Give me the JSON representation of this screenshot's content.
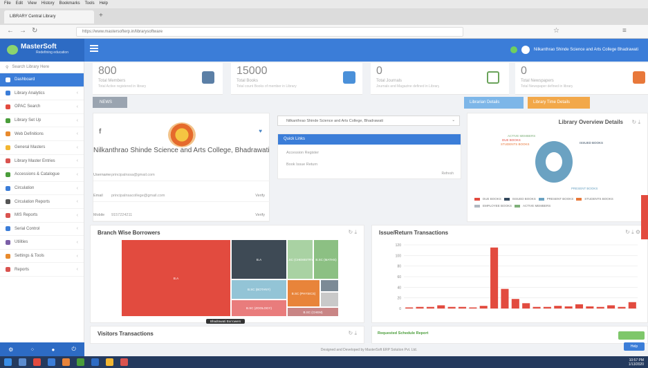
{
  "browser": {
    "menu": [
      "File",
      "Edit",
      "View",
      "History",
      "Bookmarks",
      "Tools",
      "Help"
    ],
    "tab_title": "LIBRARY Central Library",
    "url": "https://www.mastersofterp.in/librarysoftware"
  },
  "header": {
    "brand": "MasterSoft",
    "brand_sub": "Redefining education",
    "user": "Nilkanthrao Shinde Science and Arts College Bhadrawati"
  },
  "sidebar": {
    "search_placeholder": "Search Library Here",
    "items": [
      {
        "label": "Dashboard",
        "color": "#ffffff"
      },
      {
        "label": "Library Analytics",
        "color": "#3b7dd8"
      },
      {
        "label": "OPAC Search",
        "color": "#e24b3f"
      },
      {
        "label": "Library Set Up",
        "color": "#4a9d3a"
      },
      {
        "label": "Web Definitions",
        "color": "#e88a2d"
      },
      {
        "label": "General Masters",
        "color": "#f2b632"
      },
      {
        "label": "Library Master Entries",
        "color": "#d9534f"
      },
      {
        "label": "Accessions & Catalogue",
        "color": "#4a9d3a"
      },
      {
        "label": "Circulation",
        "color": "#3b7dd8"
      },
      {
        "label": "Circulation Reports",
        "color": "#555555"
      },
      {
        "label": "MIS Reports",
        "color": "#d9534f"
      },
      {
        "label": "Serial Control",
        "color": "#3b7dd8"
      },
      {
        "label": "Utilities",
        "color": "#7b5ea7"
      },
      {
        "label": "Settings & Tools",
        "color": "#e88a2d"
      },
      {
        "label": "Reports",
        "color": "#d9534f"
      }
    ]
  },
  "stats": [
    {
      "value": "800",
      "label": "Total Members",
      "desc": "Total Active registered in library",
      "icon": "user-icon",
      "color": "#5b7fa6"
    },
    {
      "value": "15000",
      "label": "Total Books",
      "desc": "Total count Books of member in Library",
      "icon": "book-icon",
      "color": "#4a90d9"
    },
    {
      "value": "0",
      "label": "Total Journals",
      "desc": "Journals and Magazine defined in Library",
      "icon": "copy-icon",
      "color": "#6aa35a"
    },
    {
      "value": "0",
      "label": "Total Newspapers",
      "desc": "Total Newspaper defined in library",
      "icon": "newspaper-icon",
      "color": "#e8783a"
    }
  ],
  "news_tag": "NEWS",
  "actions": {
    "attendance": "Librarian Details",
    "ar": "Library Time Details"
  },
  "college": {
    "name": "Nilkanthrao Shinde Science and Arts College, Bhadrawati",
    "rows": [
      {
        "label": "Username",
        "value": "principalnssa@gmail.com",
        "action": ""
      },
      {
        "label": "Email",
        "value": "principalnsacollege@gmail.com",
        "action": "Verify"
      },
      {
        "label": "Mobile",
        "value": "9157224211",
        "action": "Verify"
      }
    ]
  },
  "select_value": "Nilkanthrao Shinde Science and Arts College, Bhadrawati",
  "quick_links": {
    "title": "Quick Links",
    "items": [
      "Accession Register",
      "Book Issue Return"
    ],
    "refresh": "Refresh"
  },
  "library_overview": {
    "title": "Library Overview Details",
    "labels": [
      "ACTIVE MEMBERS",
      "DUE BOOKS",
      "STUDENTS BOOKS",
      "ISSUED BOOKS",
      "PRESENT BOOKS"
    ],
    "legend": [
      {
        "name": "DUE BOOKS",
        "color": "#e24b3f"
      },
      {
        "name": "ISSUED BOOKS",
        "color": "#34495e"
      },
      {
        "name": "PRESENT BOOKS",
        "color": "#6ba2c2"
      },
      {
        "name": "STUDENTS BOOKS",
        "color": "#e8783a"
      },
      {
        "name": "EMPLOYEE BOOKS",
        "color": "#b0b8c0"
      },
      {
        "name": "ACTIVE MEMBERS",
        "color": "#7fb07a"
      }
    ]
  },
  "branch": {
    "title": "Branch Wise Borrowers",
    "tiles": [
      {
        "label": "B.A",
        "color": "#e24b3f"
      },
      {
        "label": "B.A",
        "color": "#3e4a55"
      },
      {
        "label": "B.SC (BOTANY)",
        "color": "#93c4d6"
      },
      {
        "label": "B.SC (ZOOLOGY)",
        "color": "#e97c7c"
      },
      {
        "label": "B.SC (CHEMISTRY)",
        "color": "#a9d2a3"
      },
      {
        "label": "B.SC (MATHS)",
        "color": "#8cc083"
      },
      {
        "label": "B.SC (PHYSICS)",
        "color": "#e8843a"
      },
      {
        "label": "",
        "color": "#7c8a96"
      },
      {
        "label": "",
        "color": "#c9c9c9"
      },
      {
        "label": "B.SC (CHEM)",
        "color": "#c98585"
      }
    ],
    "tooltip": "Bhadrawati Borrowers"
  },
  "issue": {
    "title": "Issue/Return Transactions"
  },
  "visitors": {
    "title": "Visitors Transactions"
  },
  "schedule": {
    "title": "Requested Schedule Report"
  },
  "footer": "Designed and Developed by MasterSoft ERP Solution Pvt. Ltd.",
  "help": "Help",
  "clock": {
    "time": "10:57 PM",
    "date": "1/13/2020"
  },
  "chart_data": {
    "type": "bar",
    "title": "Issue/Return Transactions",
    "ylim": [
      0,
      120
    ],
    "yticks": [
      0,
      20,
      40,
      60,
      80,
      100,
      120
    ],
    "values": [
      2,
      3,
      3,
      6,
      3,
      3,
      2,
      5,
      115,
      37,
      18,
      10,
      3,
      3,
      5,
      4,
      8,
      4,
      3,
      6,
      3,
      12
    ],
    "color": "#e24b3f"
  }
}
